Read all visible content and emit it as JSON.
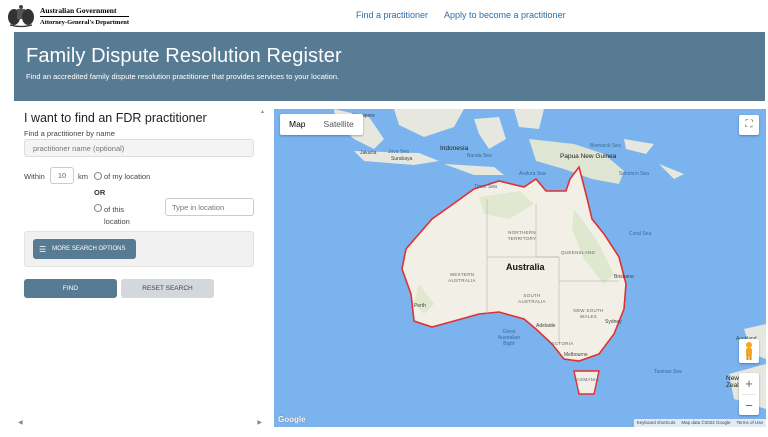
{
  "header": {
    "gov_line1": "Australian Government",
    "gov_line2": "Attorney-General's Department",
    "nav": [
      "Find a practitioner",
      "Apply to become a practitioner"
    ]
  },
  "banner": {
    "title": "Family Dispute Resolution Register",
    "subtitle": "Find an accredited family dispute resolution practitioner that provides services to your location."
  },
  "search": {
    "heading": "I want to find an FDR practitioner",
    "name_label": "Find a practitioner by name",
    "name_placeholder": "practitioner name (optional)",
    "within_label": "Within",
    "km_value": "10",
    "km_unit": "km",
    "option_my_location": "of my location",
    "or_label": "OR",
    "option_this_location": "of this location",
    "location_placeholder": "Type in location",
    "more_options_label": "MORE SEARCH OPTIONS",
    "find_label": "FIND",
    "reset_label": "RESET SEARCH"
  },
  "map": {
    "type_options": [
      "Map",
      "Satellite"
    ],
    "active_type": "Map",
    "zoom_in": "+",
    "zoom_out": "−",
    "google_label": "Google",
    "attribution": [
      "Keyboard shortcuts",
      "Map data ©2022 Google",
      "Terms of Use"
    ],
    "places": {
      "singapore": "Singapore",
      "jakarta": "Jakarta",
      "surabaya": "Surabaya",
      "indonesia": "Indonesia",
      "banda_sea": "Banda Sea",
      "java_sea": "Java Sea",
      "png": "Papua New Guinea",
      "bismarck": "Bismarck Sea",
      "solomon_sea": "Solomon Sea",
      "arafura": "Arafura Sea",
      "timor": "Timor Sea",
      "coral": "Coral Sea",
      "australia": "Australia",
      "nt": "NORTHERN TERRITORY",
      "qld": "QUEENSLAND",
      "wa": "WESTERN AUSTRALIA",
      "sa": "SOUTH AUSTRALIA",
      "nsw": "NEW SOUTH WALES",
      "vic": "VICTORIA",
      "tas": "TASMANIA",
      "brisbane": "Brisbane",
      "sydney": "Sydney",
      "perth": "Perth",
      "adelaide": "Adelaide",
      "melbourne": "Melbourne",
      "bight": "Great Australian Bight",
      "tasman": "Tasman Sea",
      "auckland": "Auckland",
      "nz": "New Zealand"
    }
  },
  "colors": {
    "banner": "#587b94",
    "nav_link": "#2e6da4",
    "water": "#7ab3ee",
    "land": "#f2efe6",
    "coast": "#e03030"
  }
}
